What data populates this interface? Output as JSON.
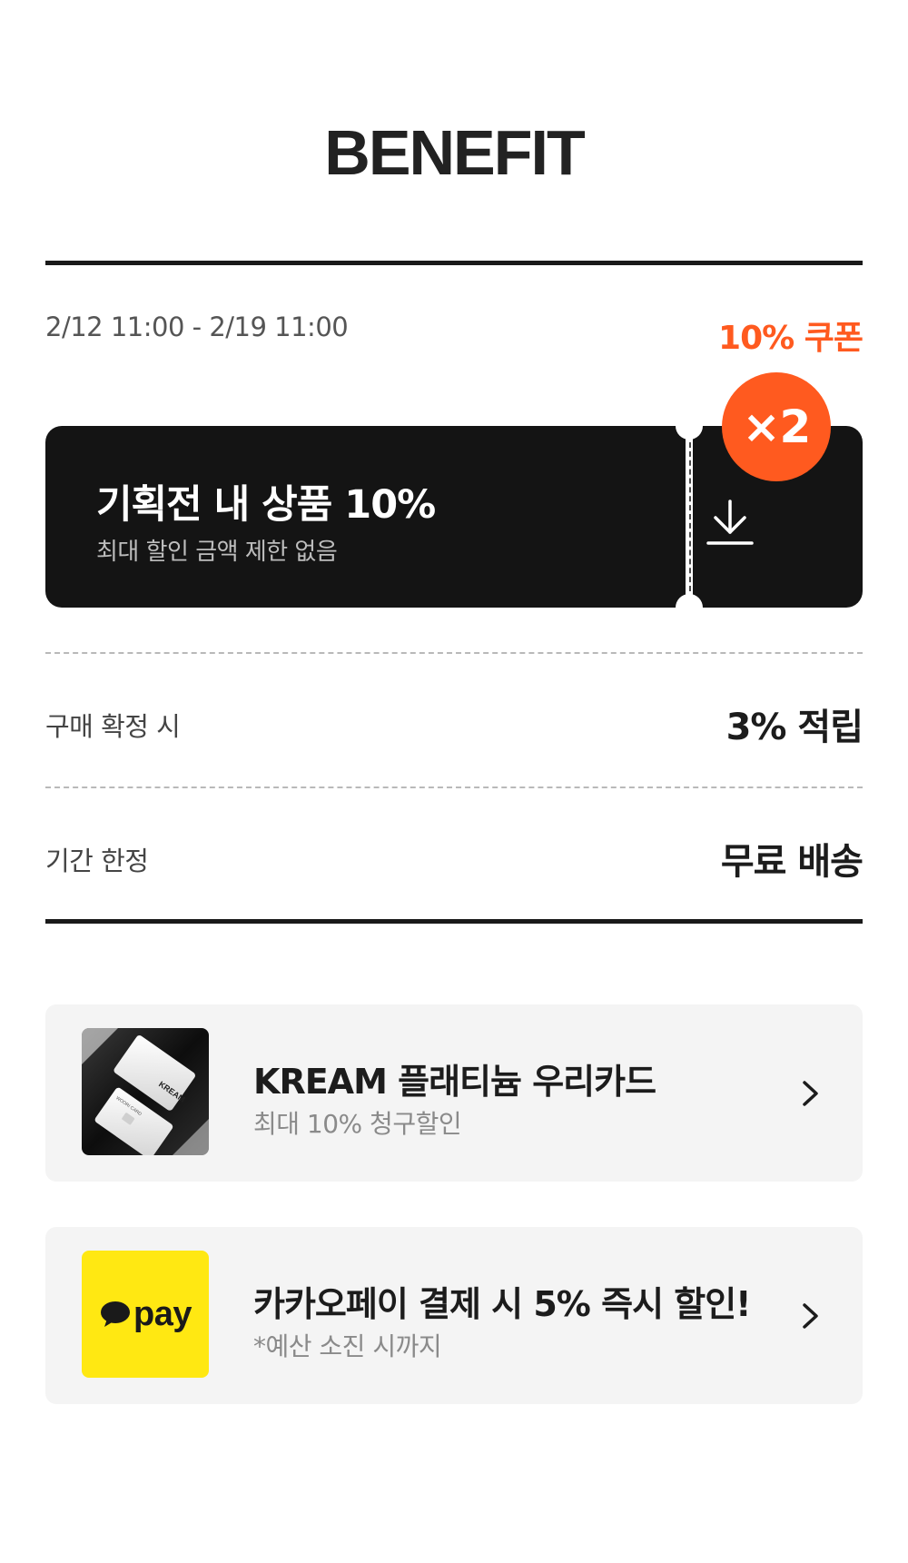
{
  "header": {
    "title": "BENEFIT"
  },
  "coupon": {
    "period": "2/12 11:00 - 2/19 11:00",
    "label": "10% 쿠폰",
    "title": "기획전 내 상품 10%",
    "subtitle": "최대 할인 금액 제한 없음",
    "badge": "×2",
    "download_icon": "download-icon"
  },
  "rows": [
    {
      "label": "구매 확정 시",
      "value": "3% 적립"
    },
    {
      "label": "기간 한정",
      "value": "무료 배송"
    }
  ],
  "promos": [
    {
      "title": "KREAM 플래티늄 우리카드",
      "subtitle": "최대 10% 청구할인",
      "thumb": "card-image",
      "card_text": "KREAM",
      "card_text_small": "WOORI CARD"
    },
    {
      "title": "카카오페이 결제 시 5% 즉시 할인!",
      "subtitle": "*예산 소진 시까지",
      "thumb": "kakaopay-logo",
      "logo_text": "pay"
    }
  ],
  "colors": {
    "accent": "#ff5a1f",
    "ticket": "#141414",
    "kakao": "#ffe812",
    "promo_bg": "#f4f4f4"
  }
}
